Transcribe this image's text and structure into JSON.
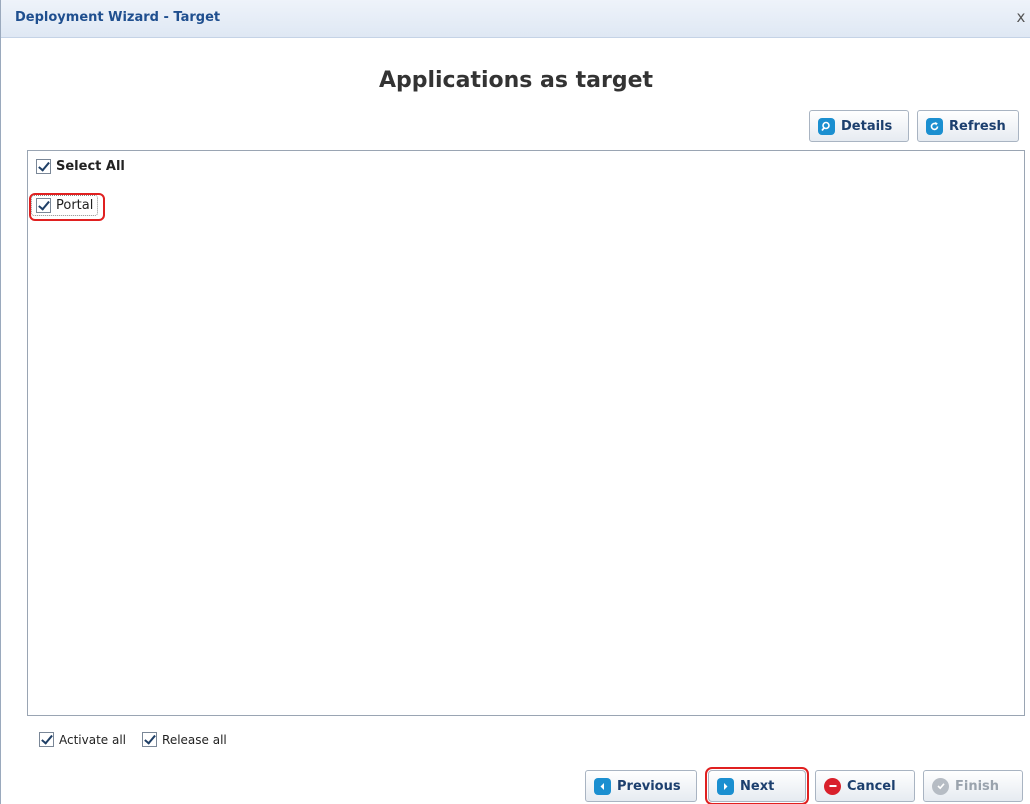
{
  "window": {
    "title": "Deployment Wizard - Target",
    "close_glyph": "x"
  },
  "heading": "Applications as target",
  "toolbar": {
    "details_label": "Details",
    "details_icon": "search-icon",
    "refresh_label": "Refresh",
    "refresh_icon": "refresh-icon"
  },
  "list": {
    "select_all": {
      "label": "Select All",
      "checked": true
    },
    "items": [
      {
        "label": "Portal",
        "checked": true
      }
    ]
  },
  "options": {
    "activate_all": {
      "label": "Activate all",
      "checked": true
    },
    "release_all": {
      "label": "Release all",
      "checked": true
    }
  },
  "footer": {
    "previous_label": "Previous",
    "next_label": "Next",
    "cancel_label": "Cancel",
    "finish_label": "Finish"
  },
  "colors": {
    "title": "#1f4f8f",
    "accent": "#1b8fd0",
    "cancel": "#d9202b",
    "highlight": "#e02020"
  }
}
